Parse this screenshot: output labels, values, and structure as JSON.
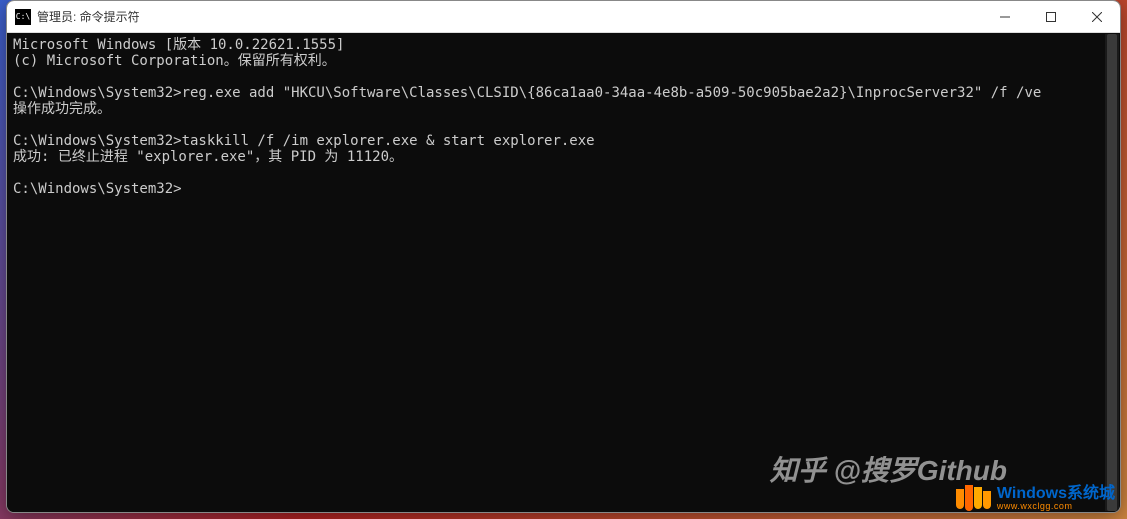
{
  "window": {
    "title": "管理员: 命令提示符",
    "icon_label": "C:\\"
  },
  "terminal": {
    "lines": [
      "Microsoft Windows [版本 10.0.22621.1555]",
      "(c) Microsoft Corporation。保留所有权利。",
      "",
      "C:\\Windows\\System32>reg.exe add \"HKCU\\Software\\Classes\\CLSID\\{86ca1aa0-34aa-4e8b-a509-50c905bae2a2}\\InprocServer32\" /f /ve",
      "操作成功完成。",
      "",
      "C:\\Windows\\System32>taskkill /f /im explorer.exe & start explorer.exe",
      "成功: 已终止进程 \"explorer.exe\"，其 PID 为 11120。",
      "",
      "C:\\Windows\\System32>"
    ]
  },
  "watermarks": {
    "zhihu": "知乎 @搜罗Github",
    "site_name": "Windows系统城",
    "site_url": "www.wxclgg.com"
  }
}
